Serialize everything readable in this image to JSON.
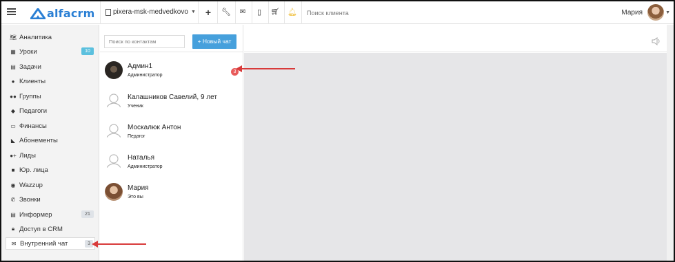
{
  "topbar": {
    "logo_text": "alfacrm",
    "branch": "pixera-msk-medvedkovo",
    "search_placeholder": "Поиск клиента",
    "user_name": "Мария"
  },
  "sidebar": {
    "items": [
      {
        "label": "Аналитика",
        "icon": "map-icon"
      },
      {
        "label": "Уроки",
        "icon": "calendar-icon",
        "badge": "10"
      },
      {
        "label": "Задачи",
        "icon": "clipboard-icon"
      },
      {
        "label": "Клиенты",
        "icon": "user-icon"
      },
      {
        "label": "Группы",
        "icon": "users-icon"
      },
      {
        "label": "Педагоги",
        "icon": "graduation-cap-icon"
      },
      {
        "label": "Финансы",
        "icon": "money-icon"
      },
      {
        "label": "Абонементы",
        "icon": "tag-icon"
      },
      {
        "label": "Лиды",
        "icon": "user-plus-icon"
      },
      {
        "label": "Юр. лица",
        "icon": "briefcase-icon"
      },
      {
        "label": "Wazzup",
        "icon": "whatsapp-icon"
      },
      {
        "label": "Звонки",
        "icon": "phone-icon"
      },
      {
        "label": "Информер",
        "icon": "newspaper-icon",
        "badge": "21"
      },
      {
        "label": "Доступ в CRM",
        "icon": "lock-icon"
      },
      {
        "label": "Внутренний чат",
        "icon": "envelope-icon",
        "badge": "3"
      }
    ]
  },
  "chatlist": {
    "search_placeholder": "Поиск по контактам",
    "new_chat_label": "+ Новый чат",
    "contacts": [
      {
        "name": "Админ1",
        "role": "Администратор",
        "unread": "3"
      },
      {
        "name": "Калашников Савелий, 9 лет",
        "role": "Ученик"
      },
      {
        "name": "Москалюк Антон",
        "role": "Педагог"
      },
      {
        "name": "Наталья",
        "role": "Администратор"
      },
      {
        "name": "Мария",
        "role": "Это вы"
      }
    ]
  },
  "colors": {
    "accent": "#46a0dc",
    "badge_red": "#e85a5a",
    "annotation_arrow": "#d83a3a",
    "logo": "#2a7fd4"
  }
}
